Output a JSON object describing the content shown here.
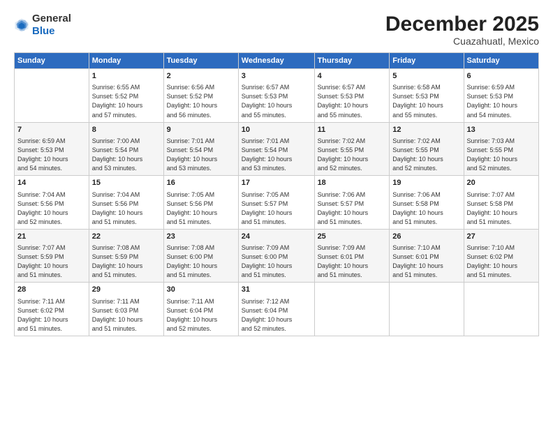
{
  "header": {
    "logo": {
      "line1": "General",
      "line2": "Blue"
    },
    "title": "December 2025",
    "location": "Cuazahuatl, Mexico"
  },
  "days_of_week": [
    "Sunday",
    "Monday",
    "Tuesday",
    "Wednesday",
    "Thursday",
    "Friday",
    "Saturday"
  ],
  "weeks": [
    [
      {
        "day": "",
        "info": ""
      },
      {
        "day": "1",
        "info": "Sunrise: 6:55 AM\nSunset: 5:52 PM\nDaylight: 10 hours\nand 57 minutes."
      },
      {
        "day": "2",
        "info": "Sunrise: 6:56 AM\nSunset: 5:52 PM\nDaylight: 10 hours\nand 56 minutes."
      },
      {
        "day": "3",
        "info": "Sunrise: 6:57 AM\nSunset: 5:53 PM\nDaylight: 10 hours\nand 55 minutes."
      },
      {
        "day": "4",
        "info": "Sunrise: 6:57 AM\nSunset: 5:53 PM\nDaylight: 10 hours\nand 55 minutes."
      },
      {
        "day": "5",
        "info": "Sunrise: 6:58 AM\nSunset: 5:53 PM\nDaylight: 10 hours\nand 55 minutes."
      },
      {
        "day": "6",
        "info": "Sunrise: 6:59 AM\nSunset: 5:53 PM\nDaylight: 10 hours\nand 54 minutes."
      }
    ],
    [
      {
        "day": "7",
        "info": "Sunrise: 6:59 AM\nSunset: 5:53 PM\nDaylight: 10 hours\nand 54 minutes."
      },
      {
        "day": "8",
        "info": "Sunrise: 7:00 AM\nSunset: 5:54 PM\nDaylight: 10 hours\nand 53 minutes."
      },
      {
        "day": "9",
        "info": "Sunrise: 7:01 AM\nSunset: 5:54 PM\nDaylight: 10 hours\nand 53 minutes."
      },
      {
        "day": "10",
        "info": "Sunrise: 7:01 AM\nSunset: 5:54 PM\nDaylight: 10 hours\nand 53 minutes."
      },
      {
        "day": "11",
        "info": "Sunrise: 7:02 AM\nSunset: 5:55 PM\nDaylight: 10 hours\nand 52 minutes."
      },
      {
        "day": "12",
        "info": "Sunrise: 7:02 AM\nSunset: 5:55 PM\nDaylight: 10 hours\nand 52 minutes."
      },
      {
        "day": "13",
        "info": "Sunrise: 7:03 AM\nSunset: 5:55 PM\nDaylight: 10 hours\nand 52 minutes."
      }
    ],
    [
      {
        "day": "14",
        "info": "Sunrise: 7:04 AM\nSunset: 5:56 PM\nDaylight: 10 hours\nand 52 minutes."
      },
      {
        "day": "15",
        "info": "Sunrise: 7:04 AM\nSunset: 5:56 PM\nDaylight: 10 hours\nand 51 minutes."
      },
      {
        "day": "16",
        "info": "Sunrise: 7:05 AM\nSunset: 5:56 PM\nDaylight: 10 hours\nand 51 minutes."
      },
      {
        "day": "17",
        "info": "Sunrise: 7:05 AM\nSunset: 5:57 PM\nDaylight: 10 hours\nand 51 minutes."
      },
      {
        "day": "18",
        "info": "Sunrise: 7:06 AM\nSunset: 5:57 PM\nDaylight: 10 hours\nand 51 minutes."
      },
      {
        "day": "19",
        "info": "Sunrise: 7:06 AM\nSunset: 5:58 PM\nDaylight: 10 hours\nand 51 minutes."
      },
      {
        "day": "20",
        "info": "Sunrise: 7:07 AM\nSunset: 5:58 PM\nDaylight: 10 hours\nand 51 minutes."
      }
    ],
    [
      {
        "day": "21",
        "info": "Sunrise: 7:07 AM\nSunset: 5:59 PM\nDaylight: 10 hours\nand 51 minutes."
      },
      {
        "day": "22",
        "info": "Sunrise: 7:08 AM\nSunset: 5:59 PM\nDaylight: 10 hours\nand 51 minutes."
      },
      {
        "day": "23",
        "info": "Sunrise: 7:08 AM\nSunset: 6:00 PM\nDaylight: 10 hours\nand 51 minutes."
      },
      {
        "day": "24",
        "info": "Sunrise: 7:09 AM\nSunset: 6:00 PM\nDaylight: 10 hours\nand 51 minutes."
      },
      {
        "day": "25",
        "info": "Sunrise: 7:09 AM\nSunset: 6:01 PM\nDaylight: 10 hours\nand 51 minutes."
      },
      {
        "day": "26",
        "info": "Sunrise: 7:10 AM\nSunset: 6:01 PM\nDaylight: 10 hours\nand 51 minutes."
      },
      {
        "day": "27",
        "info": "Sunrise: 7:10 AM\nSunset: 6:02 PM\nDaylight: 10 hours\nand 51 minutes."
      }
    ],
    [
      {
        "day": "28",
        "info": "Sunrise: 7:11 AM\nSunset: 6:02 PM\nDaylight: 10 hours\nand 51 minutes."
      },
      {
        "day": "29",
        "info": "Sunrise: 7:11 AM\nSunset: 6:03 PM\nDaylight: 10 hours\nand 51 minutes."
      },
      {
        "day": "30",
        "info": "Sunrise: 7:11 AM\nSunset: 6:04 PM\nDaylight: 10 hours\nand 52 minutes."
      },
      {
        "day": "31",
        "info": "Sunrise: 7:12 AM\nSunset: 6:04 PM\nDaylight: 10 hours\nand 52 minutes."
      },
      {
        "day": "",
        "info": ""
      },
      {
        "day": "",
        "info": ""
      },
      {
        "day": "",
        "info": ""
      }
    ]
  ]
}
